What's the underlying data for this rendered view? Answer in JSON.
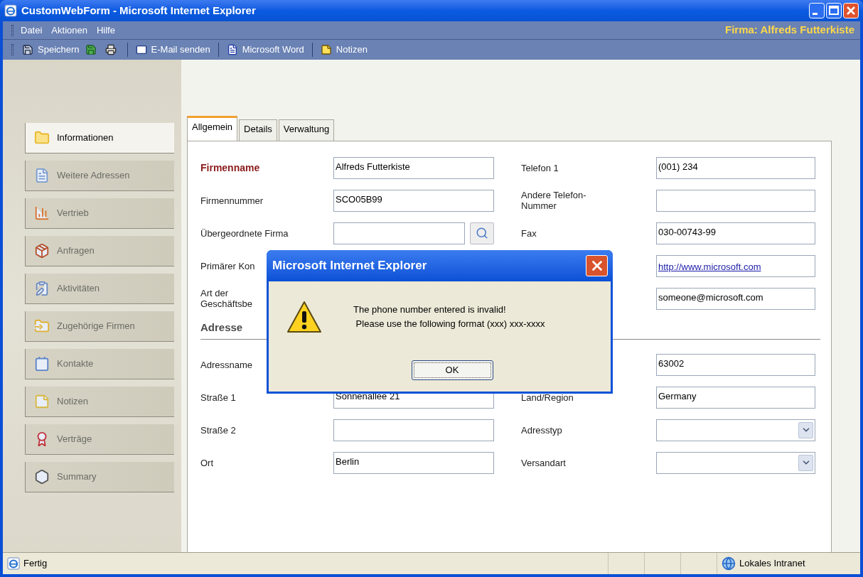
{
  "window": {
    "title": "CustomWebForm - Microsoft Internet Explorer"
  },
  "menu": [
    {
      "label": "Datei"
    },
    {
      "label": "Aktionen"
    },
    {
      "label": "Hilfe"
    }
  ],
  "company_label": "Firma: Alfreds Futterkiste",
  "toolbar": [
    {
      "kind": "button",
      "label": "Speichern"
    },
    {
      "kind": "icon"
    },
    {
      "kind": "icon"
    },
    {
      "kind": "separator"
    },
    {
      "kind": "button",
      "label": "E-Mail senden"
    },
    {
      "kind": "separator"
    },
    {
      "kind": "button",
      "label": "Microsoft Word"
    },
    {
      "kind": "separator"
    },
    {
      "kind": "button",
      "label": "Notizen"
    }
  ],
  "sidebar": {
    "items": [
      {
        "label": "Informationen",
        "selected": true
      },
      {
        "label": "Weitere Adressen",
        "selected": false
      },
      {
        "label": "Vertrieb",
        "selected": false
      },
      {
        "label": "Anfragen",
        "selected": false
      },
      {
        "label": "Aktivitäten",
        "selected": false
      },
      {
        "label": "Zugehörige Firmen",
        "selected": false
      },
      {
        "label": "Kontakte",
        "selected": false
      },
      {
        "label": "Notizen",
        "selected": false
      },
      {
        "label": "Verträge",
        "selected": false
      },
      {
        "label": "Summary",
        "selected": false
      }
    ]
  },
  "tabs": [
    {
      "label": "Allgemein",
      "selected": true
    },
    {
      "label": "Details",
      "selected": false
    },
    {
      "label": "Verwaltung",
      "selected": false
    }
  ],
  "form": {
    "rows_top": [
      {
        "left": {
          "label": "Firmenname",
          "required": true,
          "kind": "text",
          "value": "Alfreds Futterkiste"
        },
        "right": {
          "label": "Telefon 1",
          "required": false,
          "kind": "text",
          "value": "(001) 234"
        }
      },
      {
        "left": {
          "label": "Firmennummer",
          "required": false,
          "kind": "text",
          "value": "SCO05B99"
        },
        "right": {
          "label": "Andere Telefon-\nNummer",
          "required": false,
          "kind": "text"
        }
      },
      {
        "left": {
          "label": "Übergeordnete Firma",
          "required": false,
          "kind": "lookup"
        },
        "right": {
          "label": "Fax",
          "required": false,
          "kind": "text",
          "value": "030-00743-99"
        }
      },
      {
        "left": {
          "label": "Primärer Kon",
          "required": false,
          "kind": "label_only"
        },
        "right": {
          "kind": "link",
          "value": "http://www.microsoft.com"
        }
      },
      {
        "left": {
          "label": "Art der\nGeschäftsbe",
          "required": false,
          "kind": "label_only"
        },
        "right": {
          "kind": "text",
          "value": "someone@microsoft.com"
        }
      }
    ],
    "section_title": "Adresse",
    "rows_address": [
      {
        "left": {
          "label": "Adressname",
          "required": false,
          "kind": "label_only"
        },
        "right": {
          "kind": "text",
          "value": "63002"
        }
      },
      {
        "left": {
          "label": "Straße 1",
          "required": false,
          "kind": "text",
          "value": "Sonnenallee 21"
        },
        "right": {
          "label": "Land/Region",
          "required": false,
          "kind": "text",
          "value": "Germany"
        }
      },
      {
        "left": {
          "label": "Straße 2",
          "required": false,
          "kind": "text"
        },
        "right": {
          "label": "Adresstyp",
          "required": false,
          "kind": "select"
        }
      },
      {
        "left": {
          "label": "Ort",
          "required": false,
          "kind": "text",
          "value": "Berlin"
        },
        "right": {
          "label": "Versandart",
          "required": false,
          "kind": "select"
        }
      }
    ]
  },
  "dialog": {
    "title": "Microsoft Internet Explorer",
    "message_lines": [
      "The phone number entered is invalid!",
      " Please use the following format (xxx) xxx-xxxx"
    ],
    "button": "OK"
  },
  "status_bar": {
    "text": "Fertig",
    "zone": "Lokales Intranet"
  }
}
